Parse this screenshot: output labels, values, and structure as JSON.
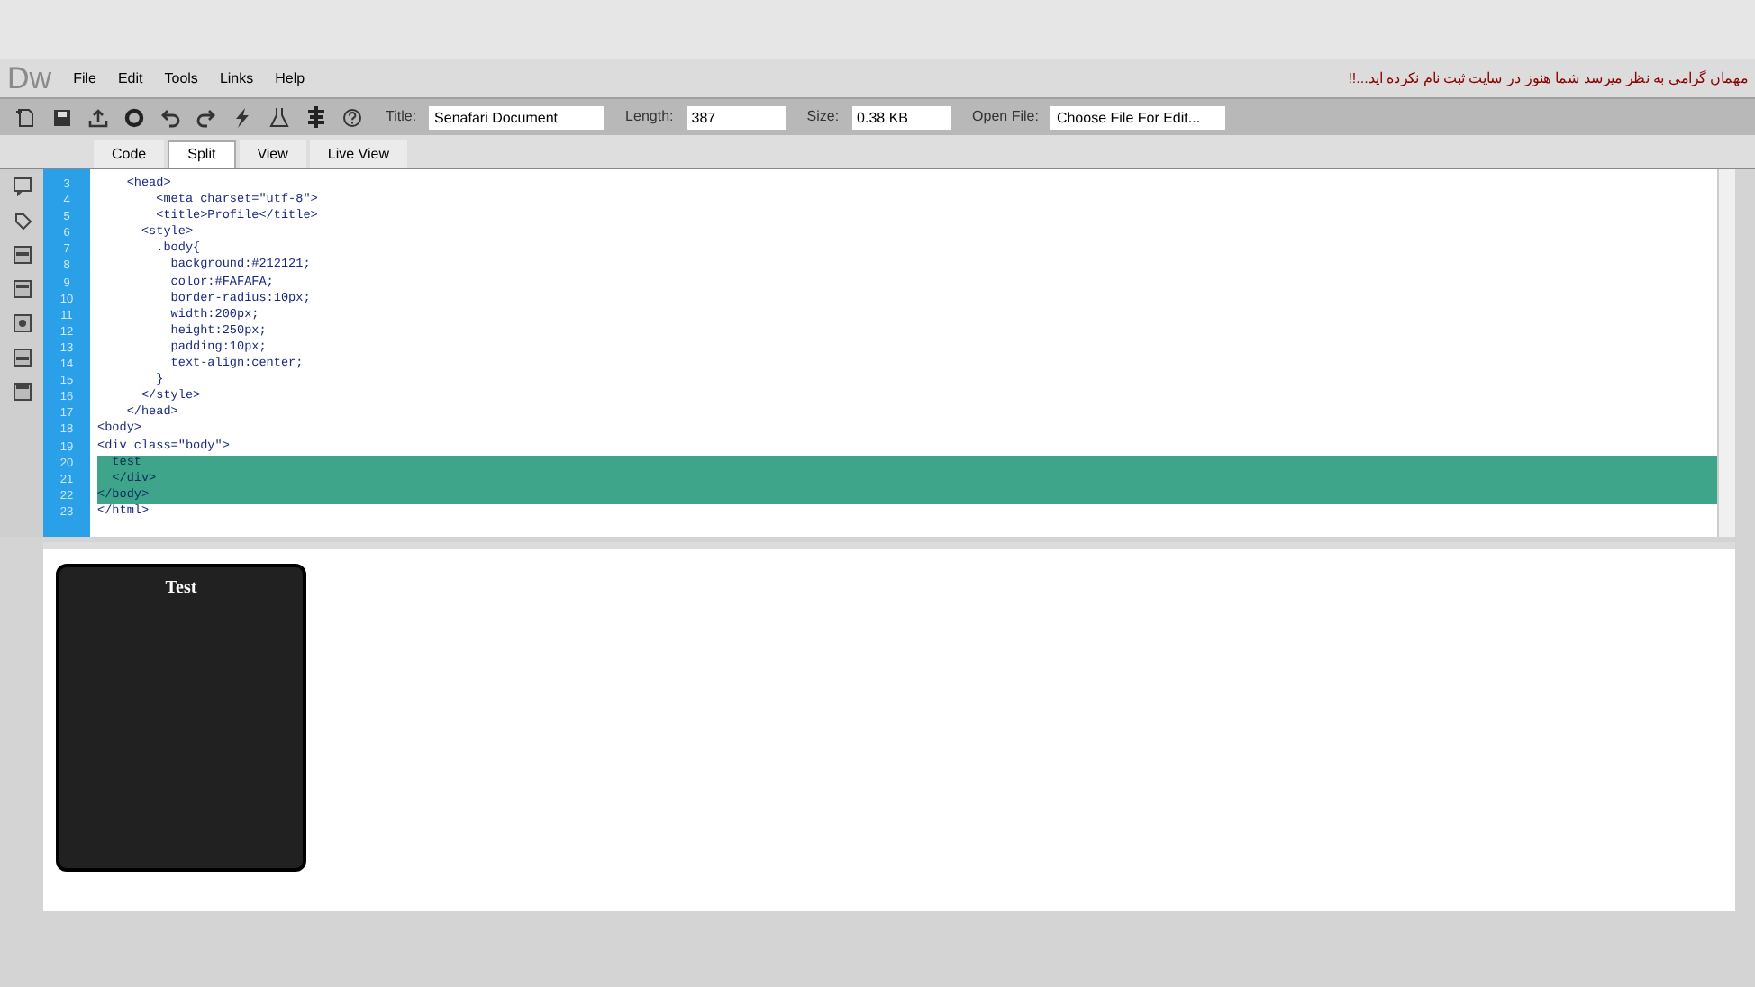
{
  "app": {
    "logo": "Dw",
    "notice": "مهمان گرامی به نظر میرسد شما هنوز در سایت ثبت نام نکرده اید...!!"
  },
  "menu": [
    "File",
    "Edit",
    "Tools",
    "Links",
    "Help"
  ],
  "toolbar": {
    "fields": [
      {
        "label": "Title:",
        "value": "Senafari Document"
      },
      {
        "label": "Length:",
        "value": "387"
      },
      {
        "label": "Size:",
        "value": "0.38 KB"
      },
      {
        "label": "Open File:",
        "value": "Choose File For Edit..."
      }
    ]
  },
  "tabs": [
    {
      "label": "Code",
      "selected": false
    },
    {
      "label": "Split",
      "selected": true
    },
    {
      "label": "View",
      "selected": false
    },
    {
      "label": "Live View",
      "selected": false
    }
  ],
  "code": [
    {
      "number": "3",
      "text": "    <head>",
      "selected": false
    },
    {
      "number": "4",
      "text": "        <meta charset=\"utf-8\">",
      "selected": false
    },
    {
      "number": "5",
      "text": "        <title>Profile</title>",
      "selected": false
    },
    {
      "number": "6",
      "text": "      <style>",
      "selected": false
    },
    {
      "number": "7",
      "text": "        .body{",
      "selected": false
    },
    {
      "number": "8",
      "text": "          background:#212121;",
      "selected": false
    },
    {
      "number": "9",
      "text": "          color:#FAFAFA;",
      "selected": false
    },
    {
      "number": "10",
      "text": "          border-radius:10px;",
      "selected": false
    },
    {
      "number": "11",
      "text": "          width:200px;",
      "selected": false
    },
    {
      "number": "12",
      "text": "          height:250px;",
      "selected": false
    },
    {
      "number": "13",
      "text": "          padding:10px;",
      "selected": false
    },
    {
      "number": "14",
      "text": "          text-align:center;",
      "selected": false
    },
    {
      "number": "15",
      "text": "        }",
      "selected": false
    },
    {
      "number": "16",
      "text": "      </style>",
      "selected": false
    },
    {
      "number": "17",
      "text": "    </head>",
      "selected": false
    },
    {
      "number": "18",
      "text": "<body>",
      "selected": false
    },
    {
      "number": "19",
      "text": "<div class=\"body\">",
      "selected": false
    },
    {
      "number": "20",
      "text": "  test",
      "selected": true
    },
    {
      "number": "21",
      "text": "  </div>",
      "selected": true
    },
    {
      "number": "22",
      "text": "</body>",
      "selected": true
    },
    {
      "number": "23",
      "text": "</html>",
      "selected": false
    }
  ],
  "preview": {
    "box_text": "Test"
  }
}
